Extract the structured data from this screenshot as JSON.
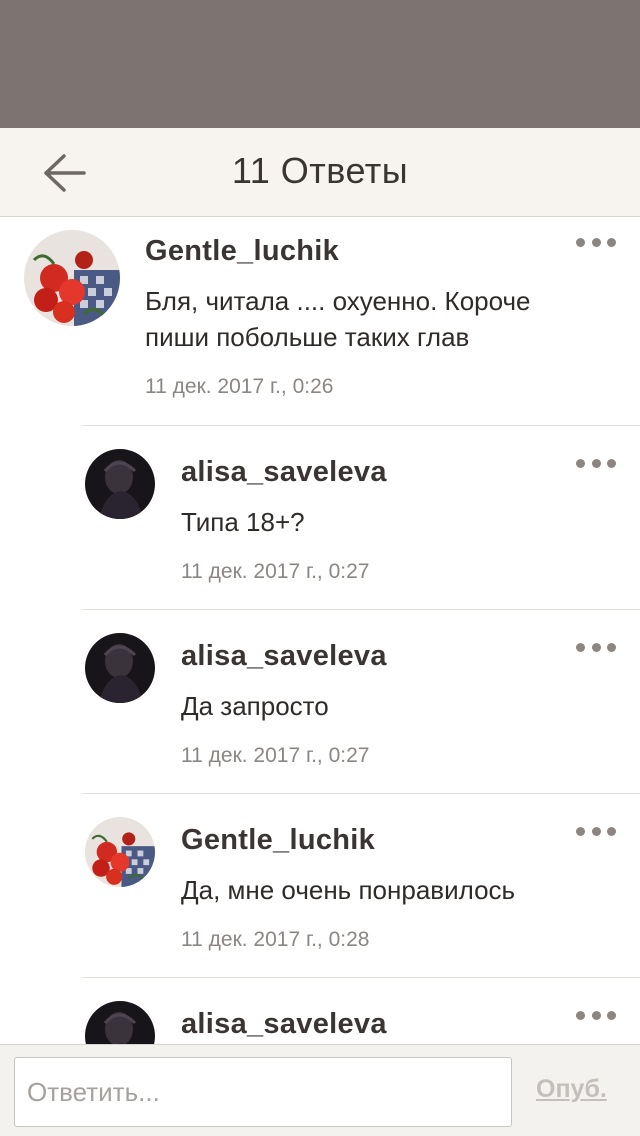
{
  "header": {
    "title": "11 Ответы",
    "back_icon": "arrow-left-icon"
  },
  "comments": [
    {
      "username": "Gentle_luchik",
      "text_lines": [
        "Бля, читала .... охуенно. Короче",
        "пиши побольше таких глав"
      ],
      "timestamp": "11 дек. 2017 г., 0:26",
      "avatar": "flowers-avatar"
    },
    {
      "username": "alisa_saveleva",
      "text_lines": [
        "Типа 18+?"
      ],
      "timestamp": "11 дек. 2017 г., 0:27",
      "avatar": "dark-portrait-avatar"
    },
    {
      "username": "alisa_saveleva",
      "text_lines": [
        "Да запросто"
      ],
      "timestamp": "11 дек. 2017 г., 0:27",
      "avatar": "dark-portrait-avatar"
    },
    {
      "username": "Gentle_luchik",
      "text_lines": [
        "Да, мне очень понравилось"
      ],
      "timestamp": "11 дек. 2017 г., 0:28",
      "avatar": "flowers-avatar"
    },
    {
      "username": "alisa_saveleva",
      "text_lines": [],
      "timestamp": "",
      "avatar": "dark-portrait-avatar"
    }
  ],
  "footer": {
    "reply_placeholder": "Ответить...",
    "publish_label": "Опуб."
  },
  "colors": {
    "status_bar": "#7b7470",
    "header_bg": "#f7f4ef",
    "text_primary": "#3a3533",
    "text_secondary": "#8c8682",
    "publish_disabled": "#c4bfbb"
  }
}
